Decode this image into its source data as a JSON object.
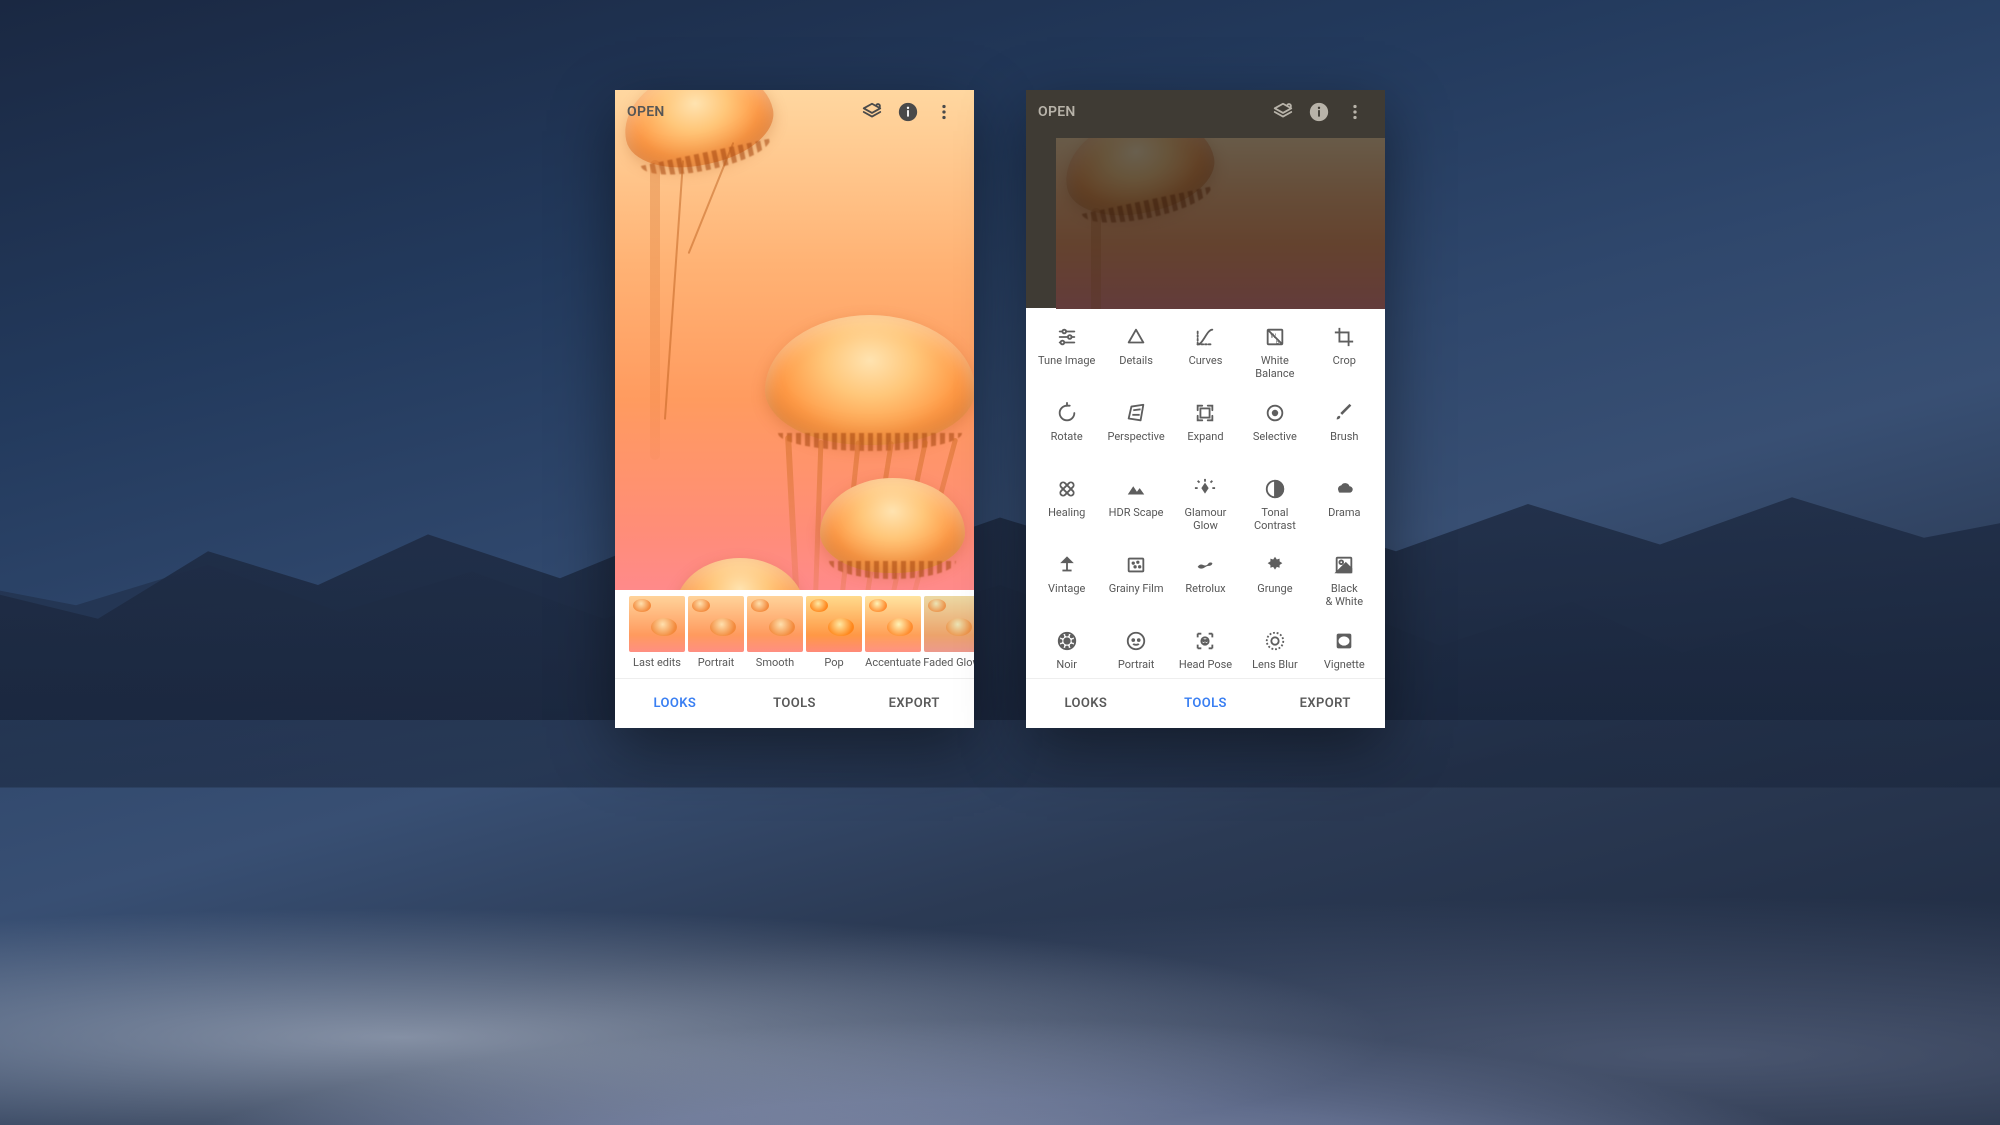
{
  "colors": {
    "accent": "#3a7ff2",
    "muted": "#5a5a5a",
    "icon": "#5e5e5e"
  },
  "common": {
    "open_label": "OPEN",
    "tabs": {
      "looks": "LOOKS",
      "tools": "TOOLS",
      "export": "EXPORT"
    }
  },
  "left": {
    "active_tab": "looks",
    "looks": [
      {
        "label": "Last edits"
      },
      {
        "label": "Portrait"
      },
      {
        "label": "Smooth"
      },
      {
        "label": "Pop"
      },
      {
        "label": "Accentuate"
      },
      {
        "label": "Faded Glow"
      }
    ]
  },
  "right": {
    "active_tab": "tools",
    "tools": [
      {
        "label": "Tune Image",
        "icon": "tune-icon"
      },
      {
        "label": "Details",
        "icon": "details-icon"
      },
      {
        "label": "Curves",
        "icon": "curves-icon"
      },
      {
        "label": "White\nBalance",
        "icon": "white-balance-icon"
      },
      {
        "label": "Crop",
        "icon": "crop-icon"
      },
      {
        "label": "Rotate",
        "icon": "rotate-icon"
      },
      {
        "label": "Perspective",
        "icon": "perspective-icon"
      },
      {
        "label": "Expand",
        "icon": "expand-icon"
      },
      {
        "label": "Selective",
        "icon": "selective-icon"
      },
      {
        "label": "Brush",
        "icon": "brush-icon"
      },
      {
        "label": "Healing",
        "icon": "healing-icon"
      },
      {
        "label": "HDR Scape",
        "icon": "hdr-icon"
      },
      {
        "label": "Glamour\nGlow",
        "icon": "glamour-icon"
      },
      {
        "label": "Tonal\nContrast",
        "icon": "tonal-icon"
      },
      {
        "label": "Drama",
        "icon": "drama-icon"
      },
      {
        "label": "Vintage",
        "icon": "vintage-icon"
      },
      {
        "label": "Grainy Film",
        "icon": "grainy-icon"
      },
      {
        "label": "Retrolux",
        "icon": "retrolux-icon"
      },
      {
        "label": "Grunge",
        "icon": "grunge-icon"
      },
      {
        "label": "Black\n& White",
        "icon": "bw-icon"
      },
      {
        "label": "Noir",
        "icon": "noir-icon"
      },
      {
        "label": "Portrait",
        "icon": "portrait-icon"
      },
      {
        "label": "Head Pose",
        "icon": "headpose-icon"
      },
      {
        "label": "Lens Blur",
        "icon": "lensblur-icon"
      },
      {
        "label": "Vignette",
        "icon": "vignette-icon"
      }
    ]
  }
}
